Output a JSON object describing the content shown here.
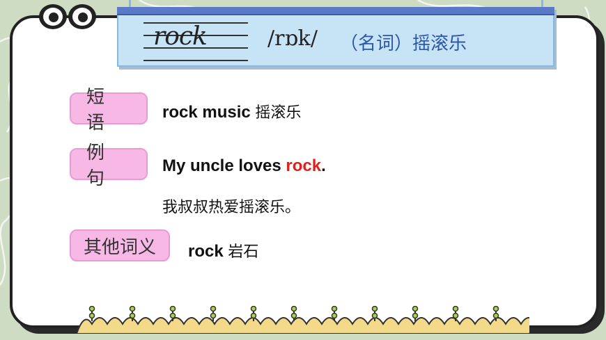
{
  "colors": {
    "background": "#cfdcc4",
    "card": "#ffffff",
    "title_board": "#c7e3f6",
    "title_band": "#5b79c9",
    "label": "#f7b8e6",
    "definition_blue": "#2c57a8",
    "highlight_red": "#e0201b"
  },
  "title": {
    "word": "rock",
    "phonetic": "/rɒk/",
    "pos_definition": "（名词）摇滚乐"
  },
  "sections": {
    "phrase": {
      "label": "短语",
      "english": "rock music",
      "chinese": "摇滚乐"
    },
    "example": {
      "label": "例句",
      "sentence_before": "My uncle loves ",
      "sentence_highlight": "rock",
      "sentence_after": ".",
      "translation": "我叔叔热爱摇滚乐。"
    },
    "other_meaning": {
      "label": "其他词义",
      "english": "rock",
      "chinese": "岩石"
    }
  },
  "icons": [
    "eyes-decoration-icon",
    "flower-ground-icon",
    "push-pin-icon"
  ]
}
